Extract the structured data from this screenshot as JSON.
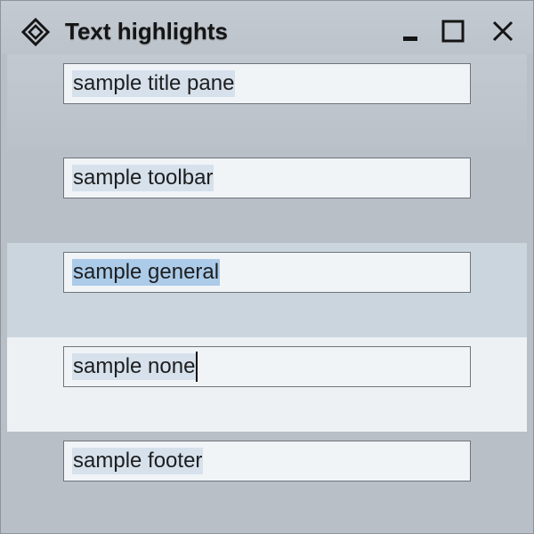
{
  "window": {
    "title": "Text highlights",
    "icon": "diamond-grid-icon",
    "buttons": [
      "minimize-icon",
      "maximize-icon",
      "close-icon"
    ]
  },
  "fields": [
    {
      "id": "title-pane",
      "value": "sample title pane",
      "state": "unfocused"
    },
    {
      "id": "toolbar",
      "value": "sample toolbar",
      "state": "unfocused"
    },
    {
      "id": "general",
      "value": "sample general",
      "state": "selected"
    },
    {
      "id": "none",
      "value": "sample none",
      "state": "focused-caret"
    },
    {
      "id": "footer",
      "value": "sample footer",
      "state": "unfocused"
    }
  ],
  "colors": {
    "selection": "#abcbe9",
    "text_highlight": "#d6e1ec",
    "field_background": "#f1f4f7"
  }
}
